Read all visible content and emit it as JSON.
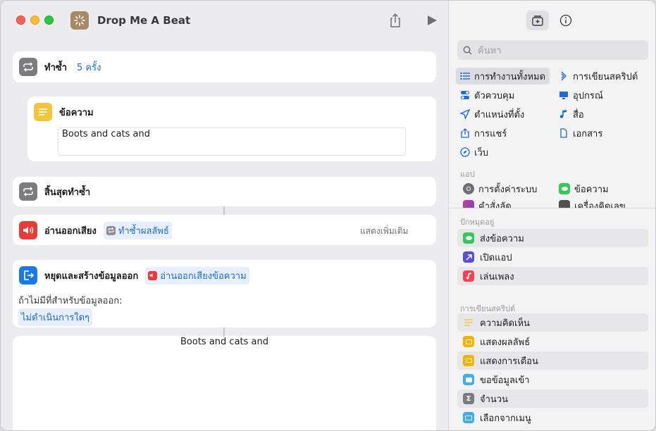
{
  "window": {
    "title": "Drop Me A Beat"
  },
  "editor": {
    "repeat": {
      "label": "ทำซ้ำ",
      "count": "5 ครั้ง"
    },
    "text": {
      "label": "ข้อความ",
      "value": "Boots and cats and"
    },
    "end_repeat": {
      "label": "สิ้นสุดทำซ้ำ"
    },
    "speak": {
      "label": "อ่านออกเสียง",
      "token": "ทำซ้ำผลลัพธ์",
      "more": "แสดงเพิ่มเติม"
    },
    "stop": {
      "label": "หยุดและสร้างข้อมูลออก",
      "token": "อ่านออกเสียงข้อความ",
      "if_none_label": "ถ้าไม่มีที่สำหรับข้อมูลออก:",
      "if_none_value": "ไม่ดำเนินการใดๆ"
    },
    "output": {
      "value": "Boots and cats and"
    }
  },
  "sidebar": {
    "search_placeholder": "ค้นหา",
    "categories": [
      {
        "label": "การทำงานทั้งหมด",
        "icon": "list-icon"
      },
      {
        "label": "การเขียนสคริปต์",
        "icon": "script-icon"
      },
      {
        "label": "ตัวควบคุม",
        "icon": "toggle-icon"
      },
      {
        "label": "อุปกรณ์",
        "icon": "display-icon"
      },
      {
        "label": "ตำแหน่งที่ตั้ง",
        "icon": "location-icon"
      },
      {
        "label": "สื่อ",
        "icon": "music-note-icon"
      },
      {
        "label": "การแชร์",
        "icon": "share-icon"
      },
      {
        "label": "เอกสาร",
        "icon": "document-icon"
      },
      {
        "label": "เว็บ",
        "icon": "compass-icon"
      }
    ],
    "apps_header": "แอป",
    "apps": [
      {
        "label": "การตั้งค่าระบบ"
      },
      {
        "label": "ข้อความ"
      },
      {
        "label": "คำสั่งลัด"
      },
      {
        "label": "เครื่องคิดเลข"
      }
    ],
    "pinned_header": "ปักหมุดอยู่",
    "pinned": [
      {
        "label": "ส่งข้อความ",
        "color": "#34c759"
      },
      {
        "label": "เปิดแอป",
        "color": "#5b4fd6"
      },
      {
        "label": "เล่นเพลง",
        "color": "#fa3e53"
      }
    ],
    "scripting_header": "การเขียนสคริปต์",
    "scripting": [
      {
        "label": "ความคิดเห็น",
        "color": "#f4c43b"
      },
      {
        "label": "แสดงผลลัพธ์",
        "color": "#f5b300"
      },
      {
        "label": "แสดงการเตือน",
        "color": "#f5b300"
      },
      {
        "label": "ขอข้อมูลเข้า",
        "color": "#3aaff2"
      },
      {
        "label": "จำนวน",
        "color": "#7a7a80"
      },
      {
        "label": "เลือกจากเมนู",
        "color": "#3aaff2"
      }
    ]
  }
}
